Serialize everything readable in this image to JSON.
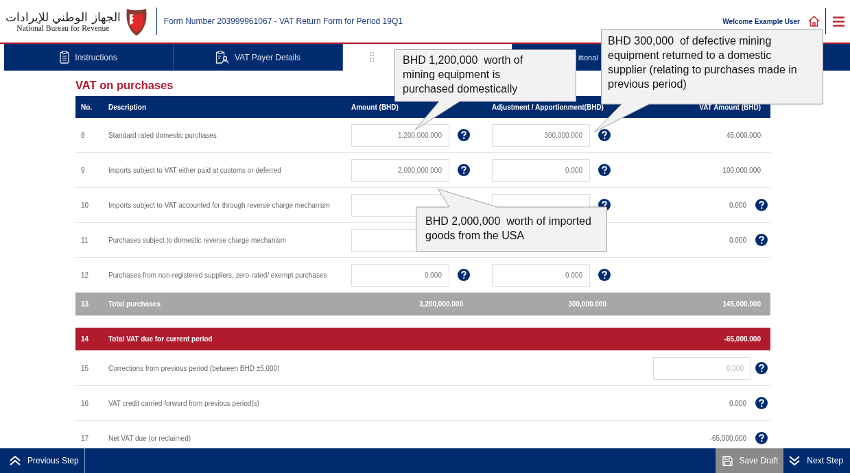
{
  "header": {
    "logo_arabic": "الجهاز الوطني للإيرادات",
    "logo_english": "National Bureau for Revenue",
    "form_title": "Form Number 203999961067 - VAT Return Form for Period 19Q1",
    "welcome": "Welcome Example User"
  },
  "tabs": [
    {
      "label": "Instructions",
      "selected": false
    },
    {
      "label": "VAT Payer Details",
      "selected": false
    },
    {
      "selected": true
    },
    {
      "label": "itional",
      "selected": false
    }
  ],
  "section_title": "VAT on purchases",
  "table": {
    "columns": [
      "No.",
      "Description",
      "Amount (BHD)",
      "Adjustment / Apportionment(BHD)",
      "VAT Amount (BHD)"
    ],
    "rows": [
      {
        "kind": "input",
        "no": "8",
        "description": "Standard rated domestic purchases",
        "amount": "1,200,000.000",
        "adjustment": "300,000.000",
        "vat": "45,000.000",
        "vat_help": false
      },
      {
        "kind": "input",
        "no": "9",
        "description": "Imports subject to VAT either paid at customs or deferred",
        "amount": "2,000,000.000",
        "adjustment": "0.000",
        "vat": "100,000.000",
        "vat_help": false
      },
      {
        "kind": "input",
        "no": "10",
        "description": "Imports subject to VAT accounted for through reverse charge mechanism",
        "vat": "0.000",
        "vat_help": true
      },
      {
        "kind": "input",
        "no": "11",
        "description": "Purchases subject to domestic reverse charge mechanism",
        "vat": "0.000",
        "vat_help": true
      },
      {
        "kind": "input",
        "no": "12",
        "description": "Purchases from non-registered suppliers, zero-rated/ exempt purchases",
        "amount": "0.000",
        "adjustment": "0.000",
        "vat_help": false
      },
      {
        "kind": "total",
        "no": "13",
        "description": "Total purchases",
        "amount": "3,200,000.000",
        "adjustment": "300,000.000",
        "vat": "145,000.000"
      }
    ]
  },
  "summary": [
    {
      "kind": "due",
      "no": "14",
      "description": "Total VAT due for current period",
      "value": "-65,000.000"
    },
    {
      "kind": "field",
      "no": "15",
      "description": "Corrections from previous period (between BHD ±5,000)",
      "placeholder": "0.000"
    },
    {
      "kind": "value",
      "no": "16",
      "description": "VAT credit carried forward from previous period(s)",
      "value": "0.000"
    },
    {
      "kind": "value",
      "no": "17",
      "description": "Net VAT due (or reclaimed)",
      "value": "-65,000.000"
    }
  ],
  "footer": {
    "previous": "Previous Step",
    "save": "Save Draft",
    "next": "Next Step"
  },
  "callouts": [
    "BHD 1,200,000  worth of mining equipment is purchased domestically",
    "BHD 300,000  of defective mining equipment returned to a domestic supplier (relating to purchases made in previous period)",
    "BHD 2,000,000  worth of imported goods from the USA"
  ]
}
